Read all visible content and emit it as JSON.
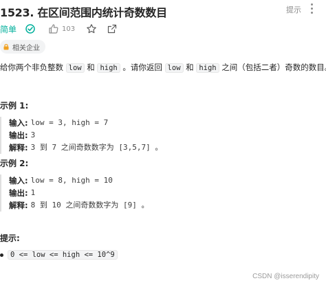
{
  "header": {
    "title": "1523. 在区间范围内统计奇数数目",
    "hint_label": "提示"
  },
  "meta": {
    "difficulty": "简单",
    "like_count": "103"
  },
  "company_tag": "相关企业",
  "description": {
    "part1": "给你两个非负整数 ",
    "code1": "low",
    "part2": " 和 ",
    "code2": "high",
    "part3": " 。请你返回 ",
    "code3": "low",
    "part4": " 和 ",
    "code4": "high",
    "part5": " 之间（包括二者）奇数的数目。"
  },
  "examples": [
    {
      "title": "示例 1:",
      "input_label": "输入:",
      "input": "low = 3, high = 7",
      "output_label": "输出:",
      "output": "3",
      "explain_label": "解释:",
      "explain": "3 到 7 之间奇数数字为 [3,5,7] 。"
    },
    {
      "title": "示例 2:",
      "input_label": "输入:",
      "input": "low = 8, high = 10",
      "output_label": "输出:",
      "output": "1",
      "explain_label": "解释:",
      "explain": "8 到 10 之间奇数数字为 [9] 。"
    }
  ],
  "tips": {
    "title": "提示:",
    "items": [
      "0 <= low <= high <= 10^9"
    ]
  },
  "watermark": "CSDN @isserendipity",
  "colors": {
    "easy": "#00af9b",
    "muted": "#8c8c8c"
  },
  "icons": [
    "solved-check-icon",
    "thumbs-up-icon",
    "star-icon",
    "share-icon",
    "lock-icon",
    "more-vertical-icon"
  ]
}
